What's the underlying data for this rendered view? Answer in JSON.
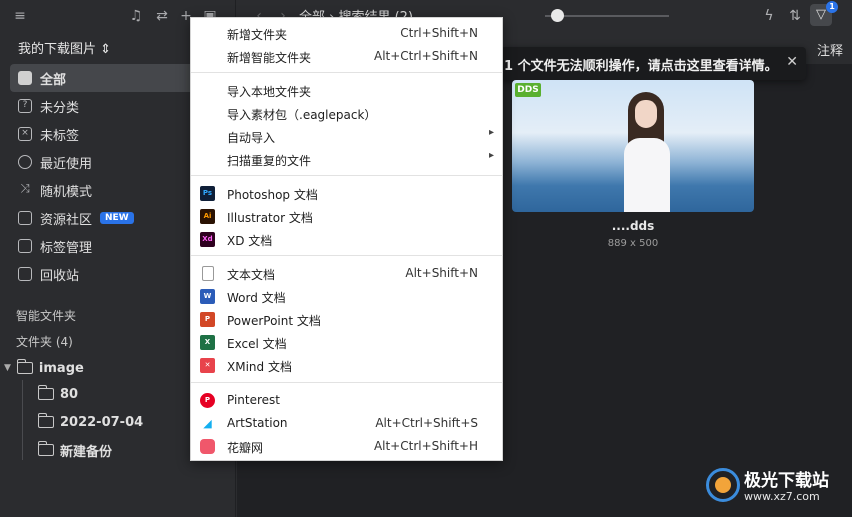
{
  "sidebar": {
    "library_name": "我的下载图片 ⇕",
    "nav": [
      {
        "label": "全部",
        "icon": "all-icon",
        "active": true
      },
      {
        "label": "未分类",
        "icon": "uncategorized-icon"
      },
      {
        "label": "未标签",
        "icon": "untagged-icon"
      },
      {
        "label": "最近使用",
        "icon": "clock-icon"
      },
      {
        "label": "随机模式",
        "icon": "shuffle-icon"
      },
      {
        "label": "资源社区",
        "icon": "community-icon",
        "badge": "NEW"
      },
      {
        "label": "标签管理",
        "icon": "tag-icon"
      },
      {
        "label": "回收站",
        "icon": "trash-icon"
      }
    ],
    "smart_folders_label": "智能文件夹",
    "folders_label": "文件夹 (4)",
    "folders": [
      {
        "label": "image"
      },
      {
        "label": "80"
      },
      {
        "label": "2022-07-04"
      },
      {
        "label": "新建备份"
      }
    ]
  },
  "topbar": {
    "breadcrumb": "全部 › 搜索结果 (2)",
    "filter_count": "1",
    "column_note": "注释"
  },
  "notice": {
    "text": "1 个文件无法顺利操作，请点击这里查看详情。",
    "close": "✕"
  },
  "file": {
    "tag": "DDS",
    "name": "....dds",
    "dimensions": "889 x 500"
  },
  "menu": {
    "items": [
      {
        "label": "新增文件夹",
        "shortcut": "Ctrl+Shift+N"
      },
      {
        "label": "新增智能文件夹",
        "shortcut": "Alt+Ctrl+Shift+N"
      },
      {
        "label": "导入本地文件夹",
        "shortcut": ""
      },
      {
        "label": "导入素材包（.eaglepack）",
        "shortcut": ""
      },
      {
        "label": "自动导入",
        "shortcut": "",
        "submenu": "▸"
      },
      {
        "label": "扫描重复的文件",
        "shortcut": "",
        "submenu": "▸"
      },
      {
        "label": "Photoshop 文档",
        "shortcut": "",
        "icon_text": "Ps"
      },
      {
        "label": "Illustrator 文档",
        "shortcut": "",
        "icon_text": "Ai"
      },
      {
        "label": "XD 文档",
        "shortcut": "",
        "icon_text": "Xd"
      },
      {
        "label": "文本文档",
        "shortcut": "Alt+Shift+N"
      },
      {
        "label": "Word 文档",
        "shortcut": "",
        "icon_text": "W"
      },
      {
        "label": "PowerPoint 文档",
        "shortcut": "",
        "icon_text": "P"
      },
      {
        "label": "Excel 文档",
        "shortcut": "",
        "icon_text": "X"
      },
      {
        "label": "XMind 文档",
        "shortcut": "",
        "icon_text": "✕"
      },
      {
        "label": "Pinterest",
        "shortcut": "",
        "icon_text": "P"
      },
      {
        "label": "ArtStation",
        "shortcut": "Alt+Ctrl+Shift+S"
      },
      {
        "label": "花瓣网",
        "shortcut": "Alt+Ctrl+Shift+H"
      }
    ]
  },
  "watermark": {
    "title": "极光下载站",
    "url": "www.xz7.com"
  },
  "colors": {
    "accent": "#2a73e8",
    "sidebar_bg": "#2b2c2f",
    "main_bg": "#202124",
    "menu_bg": "#ffffff"
  }
}
